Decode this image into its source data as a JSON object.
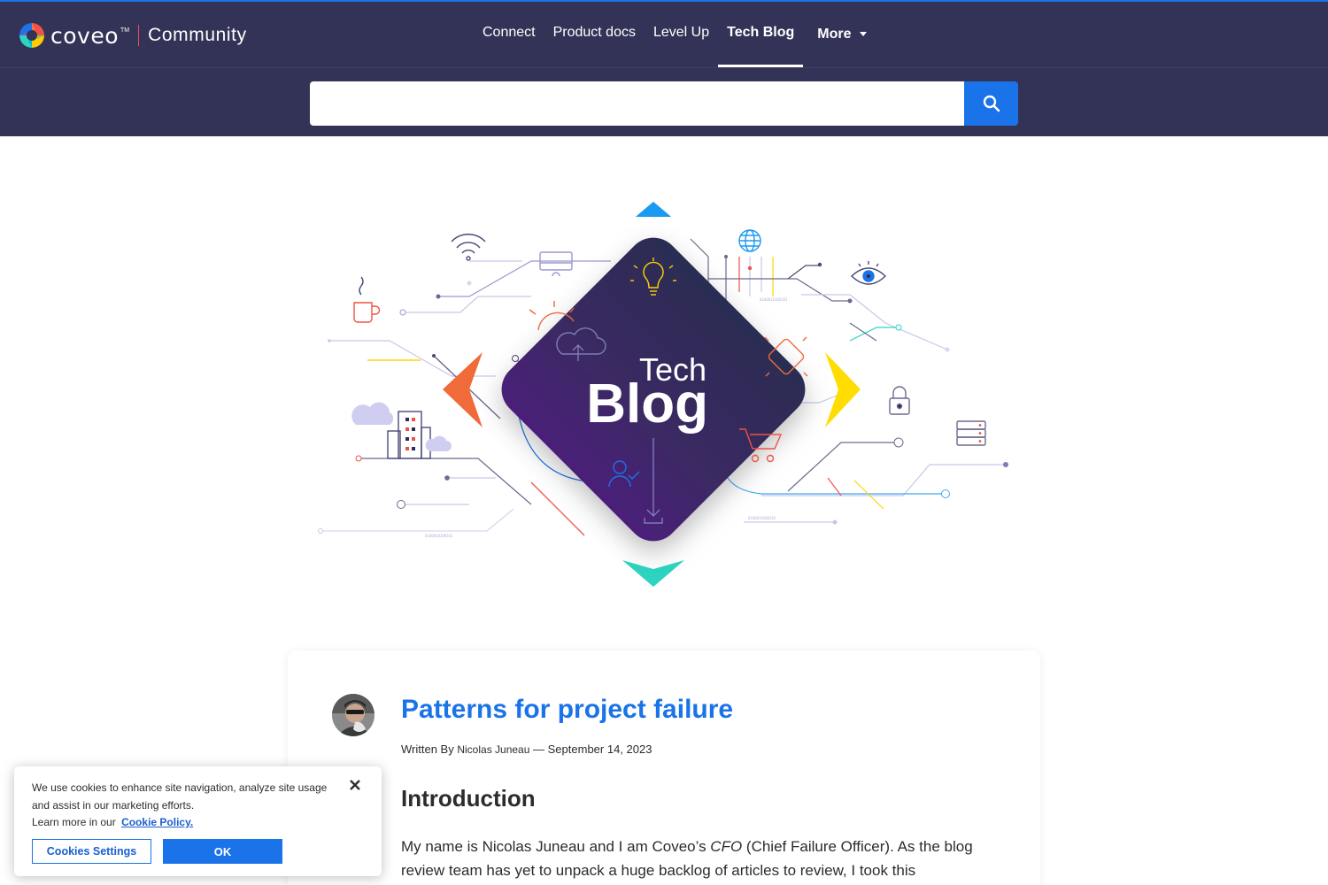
{
  "header": {
    "brand_name": "coveo",
    "brand_trademark": "TM",
    "brand_section": "Community",
    "nav": [
      {
        "label": "Connect",
        "active": false
      },
      {
        "label": "Product docs",
        "active": false
      },
      {
        "label": "Level Up",
        "active": false
      },
      {
        "label": "Tech Blog",
        "active": true
      }
    ],
    "more_label": "More",
    "search": {
      "placeholder": "",
      "value": ""
    },
    "colors": {
      "bar": "#333357",
      "accent": "#1a73e8"
    }
  },
  "hero": {
    "title_small": "Tech",
    "title_large": "Blog",
    "icons": [
      "wifi-icon",
      "monitor-icon",
      "globe-icon",
      "eye-icon",
      "coffee-mug-icon",
      "lightbulb-icon",
      "cloud-upload-icon",
      "padlock-icon",
      "cloud-icon",
      "building-icon",
      "shopping-cart-icon",
      "user-check-icon",
      "server-icon",
      "download-icon"
    ]
  },
  "post": {
    "title": "Patterns for project failure",
    "written_by_label": "Written By",
    "author": "Nicolas Juneau",
    "date_separator": " — ",
    "date": "September 14, 2023",
    "section_heading": "Introduction",
    "paragraph_start": "My name is Nicolas Juneau and I am Coveo’s ",
    "paragraph_emph": "CFO",
    "paragraph_rest": " (Chief Failure Officer). As the blog review team has yet to unpack a huge backlog of articles to review, I took this"
  },
  "cookie_banner": {
    "text": "We use cookies to enhance site navigation, analyze site usage and assist in our marketing efforts.",
    "learn_more": "Learn more in our",
    "policy_link": "Cookie Policy.",
    "settings_button": "Cookies Settings",
    "ok_button": "OK"
  }
}
